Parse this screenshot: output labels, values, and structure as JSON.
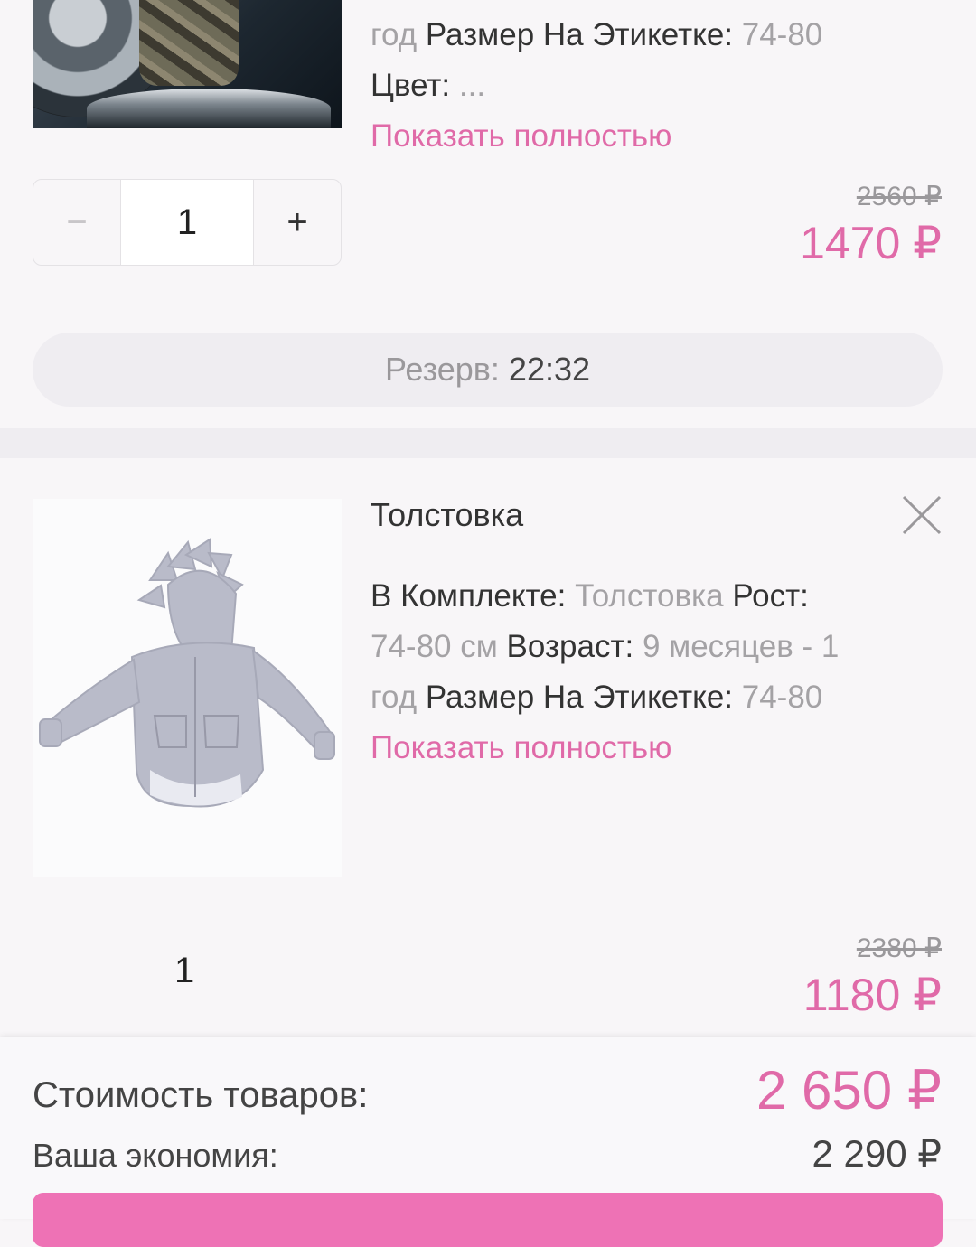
{
  "item1": {
    "desc_line1": {
      "v": "год",
      "k": "Размер На Этикетке:",
      "v2": "74-80"
    },
    "desc_line2": {
      "k": "Цвет:",
      "v": "..."
    },
    "show_more": "Показать полностью",
    "quantity": "1",
    "minus_label": "−",
    "plus_label": "+",
    "old_price": "2560 ₽",
    "new_price": "1470 ₽",
    "reserve_label": "Резерв:",
    "reserve_time": "22:32"
  },
  "item2": {
    "title": "Толстовка",
    "desc": {
      "k1": "В Комплекте:",
      "v1": "Толстовка",
      "k2": "Рост:",
      "v2": "74-80 см",
      "k3": "Возраст:",
      "v3": "9 месяцев - 1",
      "v4": "год",
      "k4": "Размер На Этикетке:",
      "v5": "74-80"
    },
    "show_more": "Показать полностью",
    "quantity": "1",
    "old_price": "2380 ₽",
    "new_price": "1180 ₽"
  },
  "summary": {
    "total_label": "Стоимость товаров:",
    "total_value": "2 650 ₽",
    "savings_label": "Ваша экономия:",
    "savings_value": "2 290 ₽"
  },
  "colors": {
    "accent": "#e06aa8",
    "button": "#ee72b5",
    "muted": "#a4a2a5"
  },
  "icons": {
    "remove": "close-icon"
  }
}
